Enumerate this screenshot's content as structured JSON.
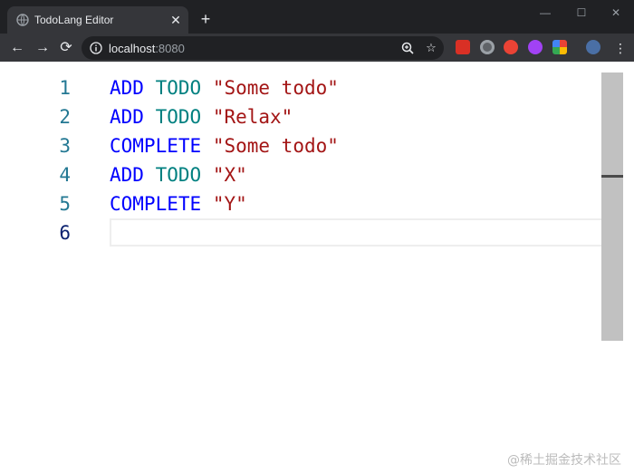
{
  "browser": {
    "tab_title": "TodoLang Editor",
    "tab_close": "✕",
    "new_tab": "+",
    "url_host": "localhost",
    "url_port": ":8080",
    "window_controls": {
      "minimize": "—",
      "maximize": "☐",
      "close": "✕"
    }
  },
  "editor": {
    "lines": [
      {
        "number": "1",
        "tokens": [
          {
            "text": "ADD",
            "kind": "kw"
          },
          {
            "text": " "
          },
          {
            "text": "TODO",
            "kind": "kw2"
          },
          {
            "text": " "
          },
          {
            "text": "\"Some todo\"",
            "kind": "str"
          }
        ]
      },
      {
        "number": "2",
        "tokens": [
          {
            "text": "ADD",
            "kind": "kw"
          },
          {
            "text": " "
          },
          {
            "text": "TODO",
            "kind": "kw2"
          },
          {
            "text": " "
          },
          {
            "text": "\"Relax\"",
            "kind": "str"
          }
        ]
      },
      {
        "number": "3",
        "tokens": [
          {
            "text": "COMPLETE",
            "kind": "kw"
          },
          {
            "text": " "
          },
          {
            "text": "\"Some todo\"",
            "kind": "str"
          }
        ]
      },
      {
        "number": "4",
        "tokens": [
          {
            "text": "ADD",
            "kind": "kw"
          },
          {
            "text": " "
          },
          {
            "text": "TODO",
            "kind": "kw2"
          },
          {
            "text": " "
          },
          {
            "text": "\"X\"",
            "kind": "str"
          }
        ]
      },
      {
        "number": "5",
        "tokens": [
          {
            "text": "COMPLETE",
            "kind": "kw"
          },
          {
            "text": " "
          },
          {
            "text": "\"Y\"",
            "kind": "str"
          }
        ]
      },
      {
        "number": "6",
        "tokens": []
      }
    ],
    "active_line": "6"
  },
  "watermark": "@稀土掘金技术社区",
  "colors": {
    "keyword": "#0000ff",
    "keyword_todo": "#008080",
    "string": "#a31515",
    "line_number": "#237893"
  }
}
